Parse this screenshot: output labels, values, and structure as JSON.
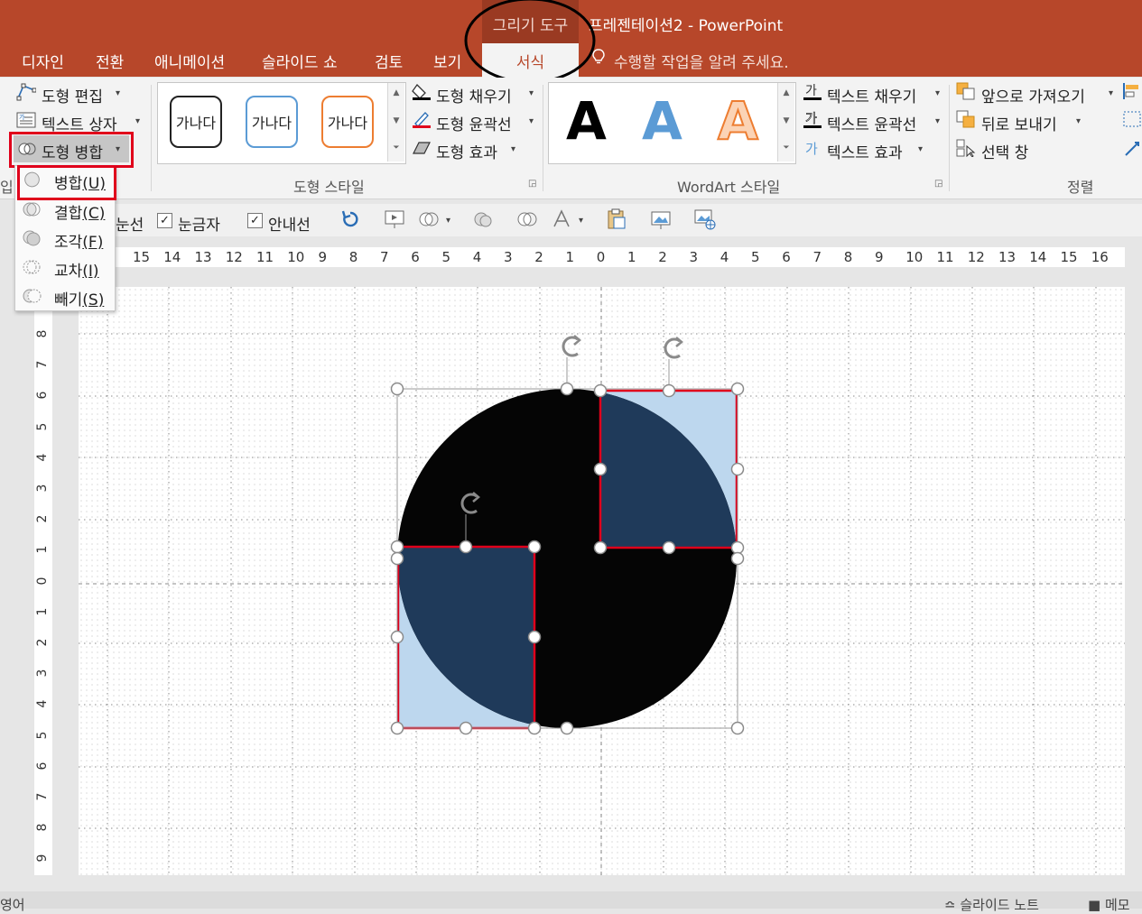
{
  "app": {
    "context_tab_group": "그리기 도구",
    "document_title": "프레젠테이션2 - PowerPoint"
  },
  "tabs": [
    "디자인",
    "전환",
    "애니메이션",
    "슬라이드 쇼",
    "검토",
    "보기"
  ],
  "active_tab": "서식",
  "tell_me": "수행할 작업을 알려 주세요.",
  "ribbon": {
    "insert_shapes": {
      "edit_shape": "도형 편집",
      "text_box": "텍스트 상자",
      "merge_shapes": "도형 병합",
      "group_label_partial": "입"
    },
    "shape_styles": {
      "preset_text": [
        "가나다",
        "가나다",
        "가나다"
      ],
      "preset_colors": [
        "#222222",
        "#5b9bd5",
        "#ed7d31"
      ],
      "fill": "도형 채우기",
      "outline": "도형 윤곽선",
      "effects": "도형 효과",
      "group_label": "도형 스타일"
    },
    "wordart": {
      "letters": [
        "A",
        "A",
        "A"
      ],
      "letter_colors": [
        "#000000",
        "#5b9bd5",
        "#ed7d31"
      ],
      "text_fill": "텍스트 채우기",
      "text_outline": "텍스트 윤곽선",
      "text_effects": "텍스트 효과",
      "group_label": "WordArt 스타일"
    },
    "arrange": {
      "bring_forward": "앞으로 가져오기",
      "send_backward": "뒤로 보내기",
      "selection_pane": "선택 창",
      "group_label": "정렬"
    }
  },
  "merge_menu": {
    "items": [
      {
        "label": "병합",
        "key": "(U)",
        "icon": "union-icon"
      },
      {
        "label": "결합",
        "key": "(C)",
        "icon": "combine-icon"
      },
      {
        "label": "조각",
        "key": "(F)",
        "icon": "fragment-icon"
      },
      {
        "label": "교차",
        "key": "(I)",
        "icon": "intersect-icon"
      },
      {
        "label": "빼기",
        "key": "(S)",
        "icon": "subtract-icon"
      }
    ]
  },
  "toolbar2": {
    "gridlines_partial": "눈선",
    "ruler": "눈금자",
    "guides": "안내선",
    "ruler_checked": true,
    "guides_checked": true
  },
  "ruler": {
    "horizontal": [
      "15",
      "14",
      "13",
      "12",
      "11",
      "10",
      "9",
      "8",
      "7",
      "6",
      "5",
      "4",
      "3",
      "2",
      "1",
      "0",
      "1",
      "2",
      "3",
      "4",
      "5",
      "6",
      "7",
      "8",
      "9",
      "10",
      "11",
      "12",
      "13",
      "14",
      "15",
      "16"
    ],
    "vertical": [
      "8",
      "7",
      "6",
      "5",
      "4",
      "3",
      "2",
      "1",
      "0",
      "1",
      "2",
      "3",
      "4",
      "5",
      "6",
      "7",
      "8",
      "9"
    ]
  },
  "status": {
    "left": "영어",
    "notes": "슬라이드 노트",
    "comments": "메모"
  },
  "colors": {
    "accent": "#b7472a",
    "highlight_red": "#e0001b",
    "shape_fill_light": "#bdd7ee",
    "shape_fill_dark": "#1f3a5a"
  }
}
